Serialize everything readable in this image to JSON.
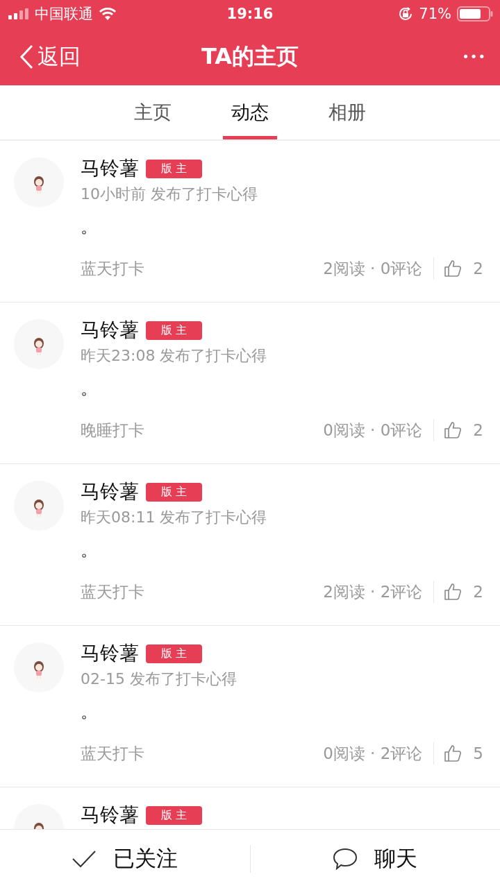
{
  "status_bar": {
    "carrier": "中国联通",
    "time": "19:16",
    "battery": "71%"
  },
  "nav": {
    "back": "返回",
    "title": "TA的主页",
    "more": "•••"
  },
  "tabs": [
    {
      "label": "主页",
      "selected": false
    },
    {
      "label": "动态",
      "selected": true
    },
    {
      "label": "相册",
      "selected": false
    }
  ],
  "posts": [
    {
      "author": "马铃薯",
      "badge": "版 主",
      "meta": "10小时前 发布了打卡心得",
      "content": "。",
      "topic": "蓝天打卡",
      "stats": "2阅读 · 0评论",
      "likes": "2"
    },
    {
      "author": "马铃薯",
      "badge": "版 主",
      "meta": "昨天23:08 发布了打卡心得",
      "content": "。",
      "topic": "晚睡打卡",
      "stats": "0阅读 · 0评论",
      "likes": "2"
    },
    {
      "author": "马铃薯",
      "badge": "版 主",
      "meta": "昨天08:11 发布了打卡心得",
      "content": "。",
      "topic": "蓝天打卡",
      "stats": "2阅读 · 2评论",
      "likes": "2"
    },
    {
      "author": "马铃薯",
      "badge": "版 主",
      "meta": "02-15 发布了打卡心得",
      "content": "。",
      "topic": "蓝天打卡",
      "stats": "0阅读 · 2评论",
      "likes": "5"
    },
    {
      "author": "马铃薯",
      "badge": "版 主"
    }
  ],
  "bottom_bar": {
    "follow": "已关注",
    "chat": "聊天"
  }
}
